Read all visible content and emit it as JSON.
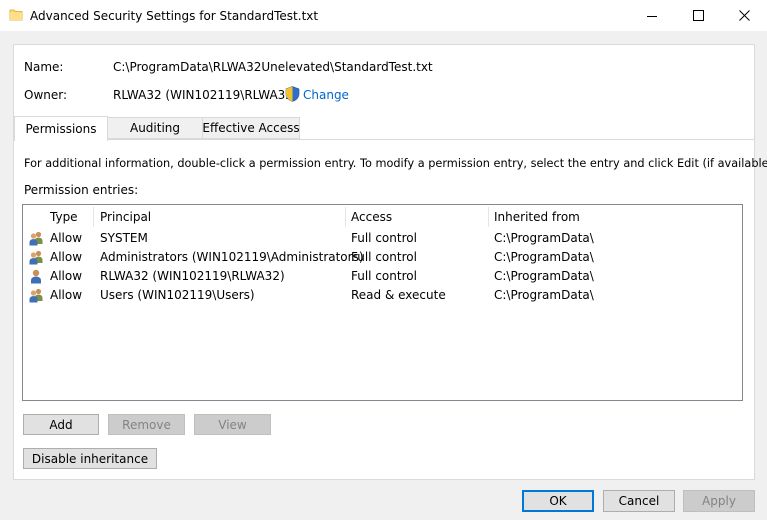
{
  "window": {
    "title": "Advanced Security Settings for StandardTest.txt",
    "icon": "folder-icon"
  },
  "file": {
    "name_label": "Name:",
    "name_value": "C:\\ProgramData\\RLWA32Unelevated\\StandardTest.txt",
    "owner_label": "Owner:",
    "owner_value": "RLWA32 (WIN102119\\RLWA32)",
    "change_link": "Change"
  },
  "tabs": [
    {
      "label": "Permissions",
      "selected": true
    },
    {
      "label": "Auditing",
      "selected": false
    },
    {
      "label": "Effective Access",
      "selected": false
    }
  ],
  "permissions": {
    "info_text": "For additional information, double-click a permission entry. To modify a permission entry, select the entry and click Edit (if available).",
    "entries_label": "Permission entries:",
    "columns": [
      "Type",
      "Principal",
      "Access",
      "Inherited from"
    ],
    "rows": [
      {
        "icon": "user-group-icon",
        "type": "Allow",
        "principal": "SYSTEM",
        "access": "Full control",
        "inherited": "C:\\ProgramData\\"
      },
      {
        "icon": "user-group-icon",
        "type": "Allow",
        "principal": "Administrators (WIN102119\\Administrators)",
        "access": "Full control",
        "inherited": "C:\\ProgramData\\"
      },
      {
        "icon": "user-icon",
        "type": "Allow",
        "principal": "RLWA32 (WIN102119\\RLWA32)",
        "access": "Full control",
        "inherited": "C:\\ProgramData\\"
      },
      {
        "icon": "user-group-icon",
        "type": "Allow",
        "principal": "Users (WIN102119\\Users)",
        "access": "Read & execute",
        "inherited": "C:\\ProgramData\\"
      }
    ]
  },
  "buttons": {
    "add": "Add",
    "remove": "Remove",
    "view": "View",
    "disable_inheritance": "Disable inheritance",
    "ok": "OK",
    "cancel": "Cancel",
    "apply": "Apply"
  },
  "colors": {
    "accent": "#0078d7",
    "link": "#0066cc",
    "disabled_text": "#838383"
  }
}
